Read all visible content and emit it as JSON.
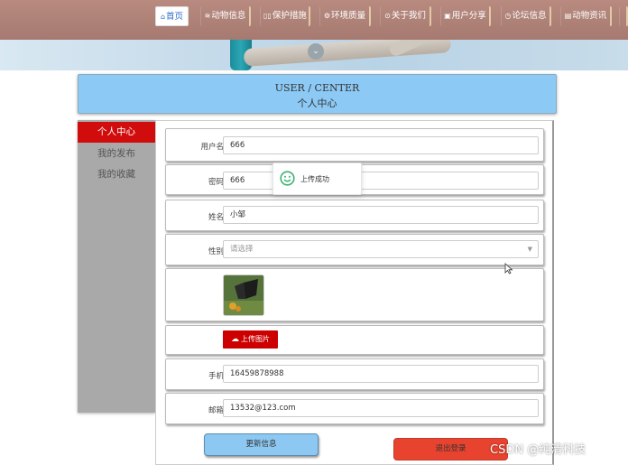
{
  "nav": {
    "items": [
      {
        "icon": "home-icon",
        "glyph": "⌂",
        "label": "首页",
        "active": true
      },
      {
        "icon": "list-icon",
        "glyph": "≋",
        "label": "动物信息"
      },
      {
        "icon": "grid-icon",
        "glyph": "▯▯",
        "label": "保护措施"
      },
      {
        "icon": "settings-icon",
        "glyph": "⚙",
        "label": "环境质量"
      },
      {
        "icon": "info-icon",
        "glyph": "⊙",
        "label": "关于我们"
      },
      {
        "icon": "share-icon",
        "glyph": "▣",
        "label": "用户分享"
      },
      {
        "icon": "clock-icon",
        "glyph": "◷",
        "label": "论坛信息"
      },
      {
        "icon": "news-icon",
        "glyph": "▤",
        "label": "动物资讯"
      }
    ]
  },
  "header": {
    "en_title": "USER / CENTER",
    "cn_title": "个人中心"
  },
  "sidebar": {
    "items": [
      {
        "label": "个人中心",
        "active": true
      },
      {
        "label": "我的发布"
      },
      {
        "label": "我的收藏"
      }
    ]
  },
  "form": {
    "username": {
      "label": "用户名",
      "value": "666"
    },
    "password": {
      "label": "密码",
      "value": "666"
    },
    "name": {
      "label": "姓名",
      "value": "小邹"
    },
    "gender": {
      "label": "性别",
      "placeholder": "请选择"
    },
    "upload_label": "上传图片",
    "phone": {
      "label": "手机",
      "value": "16459878988"
    },
    "email": {
      "label": "邮箱",
      "value": "13532@123.com"
    }
  },
  "buttons": {
    "update": "更新信息",
    "logout": "退出登录"
  },
  "toast": {
    "message": "上传成功"
  },
  "watermark": "CSDN @纯清科技",
  "colors": {
    "nav_bg": "#b08278",
    "header_bg": "#8ccaf5",
    "sidebar_active": "#d10c0c",
    "upload_btn": "#cc0000",
    "logout_btn": "#e8432f"
  }
}
